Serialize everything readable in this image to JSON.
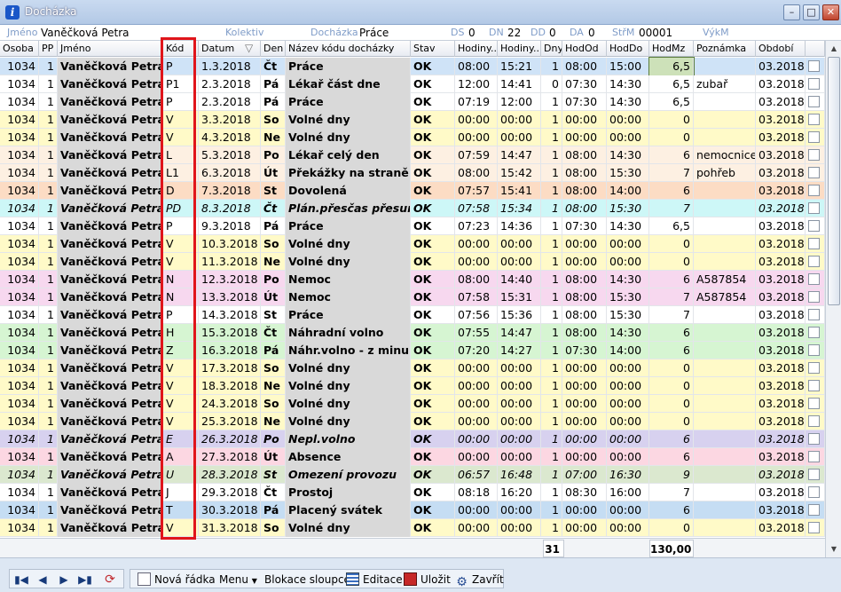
{
  "window": {
    "title": "Docházka"
  },
  "info": {
    "jmeno_label": "Jméno",
    "jmeno_value": "Vaněčková Petra",
    "kolektiv_label": "Kolektiv",
    "dochazka_label": "Docházka",
    "dochazka_value": "Práce",
    "ds_label": "DS",
    "ds_value": "0",
    "dn_label": "DN",
    "dn_value": "22",
    "dd_label": "DD",
    "dd_value": "0",
    "da_label": "DA",
    "da_value": "0",
    "strm_label": "StřM",
    "strm_value": "00001",
    "vykm_label": "VýkM"
  },
  "columns": [
    "Osoba",
    "PP",
    "Jméno",
    "Kód",
    "Datum",
    "Den",
    "Název kódu docházky",
    "Stav",
    "Hodiny...",
    "Hodiny...",
    "Dny",
    "HodOd",
    "HodDo",
    "HodMz",
    "Poznámka",
    "Období",
    ""
  ],
  "rows": [
    [
      "1034",
      "1",
      "Vaněčková Petra",
      "P",
      "1.3.2018",
      "Čt",
      "Práce",
      "OK",
      "08:00",
      "15:21",
      "1",
      "08:00",
      "15:00",
      "6,5",
      "",
      "03.2018"
    ],
    [
      "1034",
      "1",
      "Vaněčková Petra",
      "P1",
      "2.3.2018",
      "Pá",
      "Lékař část dne",
      "OK",
      "12:00",
      "14:41",
      "0",
      "07:30",
      "14:30",
      "6,5",
      "zubař",
      "03.2018"
    ],
    [
      "1034",
      "1",
      "Vaněčková Petra",
      "P",
      "2.3.2018",
      "Pá",
      "Práce",
      "OK",
      "07:19",
      "12:00",
      "1",
      "07:30",
      "14:30",
      "6,5",
      "",
      "03.2018"
    ],
    [
      "1034",
      "1",
      "Vaněčková Petra",
      "V",
      "3.3.2018",
      "So",
      "Volné dny",
      "OK",
      "00:00",
      "00:00",
      "1",
      "00:00",
      "00:00",
      "0",
      "",
      "03.2018"
    ],
    [
      "1034",
      "1",
      "Vaněčková Petra",
      "V",
      "4.3.2018",
      "Ne",
      "Volné dny",
      "OK",
      "00:00",
      "00:00",
      "1",
      "00:00",
      "00:00",
      "0",
      "",
      "03.2018"
    ],
    [
      "1034",
      "1",
      "Vaněčková Petra",
      "L",
      "5.3.2018",
      "Po",
      "Lékař celý den",
      "OK",
      "07:59",
      "14:47",
      "1",
      "08:00",
      "14:30",
      "6",
      "nemocnice",
      "03.2018"
    ],
    [
      "1034",
      "1",
      "Vaněčková Petra",
      "L1",
      "6.3.2018",
      "Út",
      "Překážky na straně zaměstnance",
      "OK",
      "08:00",
      "15:42",
      "1",
      "08:00",
      "15:30",
      "7",
      "pohřeb",
      "03.2018"
    ],
    [
      "1034",
      "1",
      "Vaněčková Petra",
      "D",
      "7.3.2018",
      "St",
      "Dovolená",
      "OK",
      "07:57",
      "15:41",
      "1",
      "08:00",
      "14:00",
      "6",
      "",
      "03.2018"
    ],
    [
      "1034",
      "1",
      "Vaněčková Petra",
      "PD",
      "8.3.2018",
      "Čt",
      "Plán.přesčas přesunutý",
      "OK",
      "07:58",
      "15:34",
      "1",
      "08:00",
      "15:30",
      "7",
      "",
      "03.2018"
    ],
    [
      "1034",
      "1",
      "Vaněčková Petra",
      "P",
      "9.3.2018",
      "Pá",
      "Práce",
      "OK",
      "07:23",
      "14:36",
      "1",
      "07:30",
      "14:30",
      "6,5",
      "",
      "03.2018"
    ],
    [
      "1034",
      "1",
      "Vaněčková Petra",
      "V",
      "10.3.2018",
      "So",
      "Volné dny",
      "OK",
      "00:00",
      "00:00",
      "1",
      "00:00",
      "00:00",
      "0",
      "",
      "03.2018"
    ],
    [
      "1034",
      "1",
      "Vaněčková Petra",
      "V",
      "11.3.2018",
      "Ne",
      "Volné dny",
      "OK",
      "00:00",
      "00:00",
      "1",
      "00:00",
      "00:00",
      "0",
      "",
      "03.2018"
    ],
    [
      "1034",
      "1",
      "Vaněčková Petra",
      "N",
      "12.3.2018",
      "Po",
      "Nemoc",
      "OK",
      "08:00",
      "14:40",
      "1",
      "08:00",
      "14:30",
      "6",
      "A587854",
      "03.2018"
    ],
    [
      "1034",
      "1",
      "Vaněčková Petra",
      "N",
      "13.3.2018",
      "Út",
      "Nemoc",
      "OK",
      "07:58",
      "15:31",
      "1",
      "08:00",
      "15:30",
      "7",
      "A587854",
      "03.2018"
    ],
    [
      "1034",
      "1",
      "Vaněčková Petra",
      "P",
      "14.3.2018",
      "St",
      "Práce",
      "OK",
      "07:56",
      "15:36",
      "1",
      "08:00",
      "15:30",
      "7",
      "",
      "03.2018"
    ],
    [
      "1034",
      "1",
      "Vaněčková Petra",
      "H",
      "15.3.2018",
      "Čt",
      "Náhradní volno",
      "OK",
      "07:55",
      "14:47",
      "1",
      "08:00",
      "14:30",
      "6",
      "",
      "03.2018"
    ],
    [
      "1034",
      "1",
      "Vaněčková Petra",
      "Z",
      "16.3.2018",
      "Pá",
      "Náhr.volno - z minulého",
      "OK",
      "07:20",
      "14:27",
      "1",
      "07:30",
      "14:00",
      "6",
      "",
      "03.2018"
    ],
    [
      "1034",
      "1",
      "Vaněčková Petra",
      "V",
      "17.3.2018",
      "So",
      "Volné dny",
      "OK",
      "00:00",
      "00:00",
      "1",
      "00:00",
      "00:00",
      "0",
      "",
      "03.2018"
    ],
    [
      "1034",
      "1",
      "Vaněčková Petra",
      "V",
      "18.3.2018",
      "Ne",
      "Volné dny",
      "OK",
      "00:00",
      "00:00",
      "1",
      "00:00",
      "00:00",
      "0",
      "",
      "03.2018"
    ],
    [
      "1034",
      "1",
      "Vaněčková Petra",
      "V",
      "24.3.2018",
      "So",
      "Volné dny",
      "OK",
      "00:00",
      "00:00",
      "1",
      "00:00",
      "00:00",
      "0",
      "",
      "03.2018"
    ],
    [
      "1034",
      "1",
      "Vaněčková Petra",
      "V",
      "25.3.2018",
      "Ne",
      "Volné dny",
      "OK",
      "00:00",
      "00:00",
      "1",
      "00:00",
      "00:00",
      "0",
      "",
      "03.2018"
    ],
    [
      "1034",
      "1",
      "Vaněčková Petra",
      "E",
      "26.3.2018",
      "Po",
      "Nepl.volno",
      "OK",
      "00:00",
      "00:00",
      "1",
      "00:00",
      "00:00",
      "6",
      "",
      "03.2018"
    ],
    [
      "1034",
      "1",
      "Vaněčková Petra",
      "A",
      "27.3.2018",
      "Út",
      "Absence",
      "OK",
      "00:00",
      "00:00",
      "1",
      "00:00",
      "00:00",
      "6",
      "",
      "03.2018"
    ],
    [
      "1034",
      "1",
      "Vaněčková Petra",
      "U",
      "28.3.2018",
      "St",
      "Omezení provozu",
      "OK",
      "06:57",
      "16:48",
      "1",
      "07:00",
      "16:30",
      "9",
      "",
      "03.2018"
    ],
    [
      "1034",
      "1",
      "Vaněčková Petra",
      "J",
      "29.3.2018",
      "Čt",
      "Prostoj",
      "OK",
      "08:18",
      "16:20",
      "1",
      "08:30",
      "16:00",
      "7",
      "",
      "03.2018"
    ],
    [
      "1034",
      "1",
      "Vaněčková Petra",
      "T",
      "30.3.2018",
      "Pá",
      "Placený svátek",
      "OK",
      "00:00",
      "00:00",
      "1",
      "00:00",
      "00:00",
      "6",
      "",
      "03.2018"
    ],
    [
      "1034",
      "1",
      "Vaněčková Petra",
      "V",
      "31.3.2018",
      "So",
      "Volné dny",
      "OK",
      "00:00",
      "00:00",
      "1",
      "00:00",
      "00:00",
      "0",
      "",
      "03.2018"
    ]
  ],
  "row_colors": [
    "#cfe3f7",
    "#ffffff",
    "#ffffff",
    "#fffac8",
    "#fffac8",
    "#fdf0e2",
    "#fdf0e2",
    "#fcdcc4",
    "#cdf7f7",
    "#ffffff",
    "#fffac8",
    "#fffac8",
    "#f7d8ef",
    "#f7d8ef",
    "#ffffff",
    "#d6f5d2",
    "#d6f5d2",
    "#fffac8",
    "#fffac8",
    "#fffac8",
    "#fffac8",
    "#d7d1ef",
    "#fcd7e2",
    "#dbe8cf",
    "#ffffff",
    "#c5ddf3",
    "#fffac8"
  ],
  "italic_rows": [
    8,
    21,
    23
  ],
  "totals": {
    "dny": "31",
    "hodmz": "130,00"
  },
  "toolbar": {
    "nova_radka": "Nová řádka",
    "menu": "Menu",
    "blokace": "Blokace sloupce",
    "editace": "Editace",
    "ulozit": "Uložit",
    "zavrit": "Zavřít"
  },
  "colors": {
    "highlight_box": "#e0151b"
  }
}
